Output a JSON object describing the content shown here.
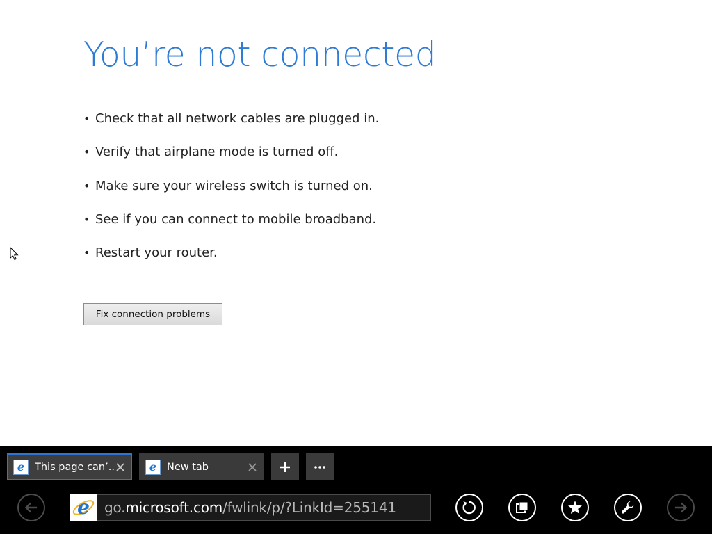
{
  "error_page": {
    "headline": "You’re not connected",
    "tips": [
      "Check that all network cables are plugged in.",
      "Verify that airplane mode is turned off.",
      "Make sure your wireless switch is turned on.",
      "See if you can connect to mobile broadband.",
      "Restart your router."
    ],
    "fix_button_label": "Fix connection problems"
  },
  "tabs": [
    {
      "title": "This page can’...",
      "active": true,
      "icon": "ie-favicon-icon"
    },
    {
      "title": "New tab",
      "active": false,
      "icon": "ie-favicon-icon"
    }
  ],
  "tab_actions": {
    "new_tab_icon": "plus-icon",
    "tab_tools_icon": "more-icon"
  },
  "address_bar": {
    "url_prefix": "go.",
    "url_domain": "microsoft.com",
    "url_path": "/fwlink/p/?LinkId=255141",
    "site_icon": "ie-logo-icon"
  },
  "nav_buttons": {
    "back": "back-arrow-icon",
    "refresh": "refresh-icon",
    "pin": "pin-icon",
    "favorites": "star-icon",
    "tools": "wrench-icon",
    "forward": "forward-arrow-icon"
  },
  "colors": {
    "headline": "#2e7bd6",
    "appbar_bg": "#000000",
    "tab_bg": "#3a3a3a",
    "active_tab_border": "#2e74d2"
  }
}
